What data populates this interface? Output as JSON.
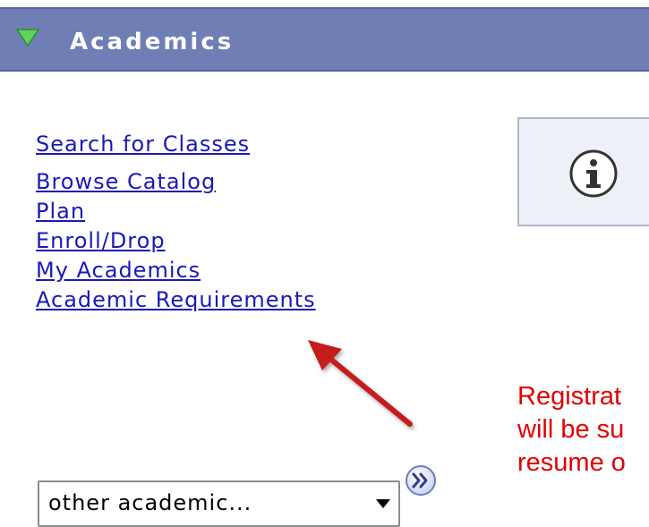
{
  "header": {
    "title": "Academics",
    "collapse_icon": "triangle-down-icon",
    "colors": {
      "bar": "#6f7fb5",
      "triangle": "#5fd35f"
    }
  },
  "links": [
    {
      "label": "Search for Classes"
    },
    {
      "label": "Browse Catalog"
    },
    {
      "label": "Plan"
    },
    {
      "label": "Enroll/Drop"
    },
    {
      "label": "My Academics"
    },
    {
      "label": "Academic Requirements"
    }
  ],
  "info_panel": {
    "icon": "info-icon"
  },
  "message": {
    "lines": [
      "Registrat",
      "will be su",
      "resume o"
    ],
    "color": "#e20000"
  },
  "annotation": {
    "icon": "red-arrow-icon",
    "color": "#c51c1c"
  },
  "dropdown": {
    "selected": "other academic...",
    "caret_icon": "caret-down-icon"
  },
  "go_button": {
    "icon": "double-chevron-right-icon"
  },
  "link_color": "#1a19b8"
}
